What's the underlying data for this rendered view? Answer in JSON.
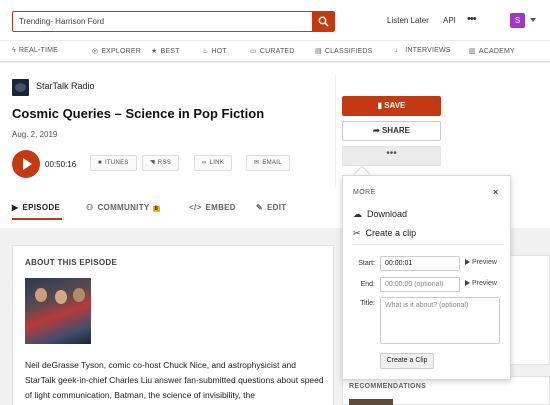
{
  "search": {
    "value": "Trending- Harrison Ford"
  },
  "header": {
    "listen_later": "Listen Later",
    "api": "API",
    "more": "•••",
    "avatar_letter": "S"
  },
  "nav": [
    {
      "label": "REAL-TIME",
      "icon": "bolt-icon"
    },
    {
      "label": "EXPLORER",
      "icon": "compass-icon"
    },
    {
      "label": "BEST",
      "icon": "star-icon"
    },
    {
      "label": "HOT",
      "icon": "flame-icon"
    },
    {
      "label": "CURATED",
      "icon": "folder-icon"
    },
    {
      "label": "CLASSIFIEDS",
      "icon": "newspaper-icon"
    },
    {
      "label": "INTERVIEWS",
      "icon": "microphone-icon"
    },
    {
      "label": "ACADEMY",
      "icon": "book-icon"
    }
  ],
  "episode": {
    "show": "StarTalk Radio",
    "title": "Cosmic Queries – Science in Pop Fiction",
    "date": "Aug. 2, 2019",
    "duration": "00:50:16",
    "links": [
      "ITUNES",
      "RSS",
      "LINK",
      "EMAIL"
    ]
  },
  "tabs": [
    {
      "label": "EPISODE"
    },
    {
      "label": "COMMUNITY",
      "badge": "8"
    },
    {
      "label": "EMBED"
    },
    {
      "label": "EDIT"
    }
  ],
  "actions": {
    "save": "SAVE",
    "share": "SHARE",
    "more": "•••"
  },
  "about": {
    "title": "ABOUT THIS EPISODE",
    "text": "Neil deGrasse Tyson, comic co-host Chuck Nice, and astrophysicist and StarTalk geek-in-chief Charles Liu answer fan-submitted questions about speed of light communication, Batman, the science of invisibility, the"
  },
  "recommendations": {
    "title": "RECOMMENDATIONS"
  },
  "popup": {
    "title": "MORE",
    "close": "×",
    "download": "Download",
    "create_clip": "Create a clip",
    "start_label": "Start:",
    "start_value": "00:00:01",
    "end_label": "End:",
    "end_placeholder": "00:00:00 (optional)",
    "title_label": "Title:",
    "title_placeholder": "What is it about? (optional)",
    "preview": "Preview",
    "submit": "Create a Clip"
  },
  "colors": {
    "accent": "#c33a12",
    "badge": "#e8b800",
    "avatar": "#a237c4"
  }
}
